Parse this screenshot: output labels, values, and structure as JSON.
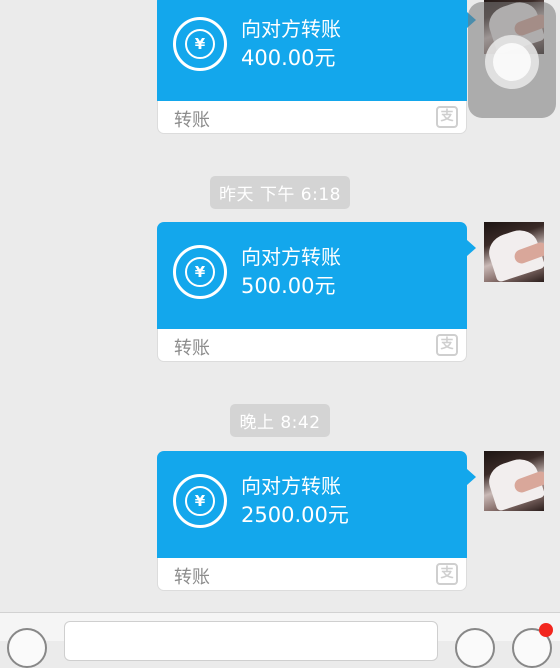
{
  "messages": [
    {
      "title": "向对方转账",
      "amount": "400.00元",
      "label": "转账"
    },
    {
      "title": "向对方转账",
      "amount": "500.00元",
      "label": "转账"
    },
    {
      "title": "向对方转账",
      "amount": "2500.00元",
      "label": "转账"
    }
  ],
  "timestamps": [
    "昨天 下午 6:18",
    "晚上 8:42"
  ],
  "icons": {
    "transfer": "yen-transfer-icon",
    "alipay": "alipay-icon",
    "assistive_touch": "assistive-touch-icon",
    "voice": "voice-icon",
    "emoji": "emoji-icon",
    "plus": "plus-icon"
  },
  "colors": {
    "card": "#13a7ec",
    "background": "#ebebeb",
    "timestamp_bg": "#d4d4d4",
    "badge": "#f2261e"
  }
}
